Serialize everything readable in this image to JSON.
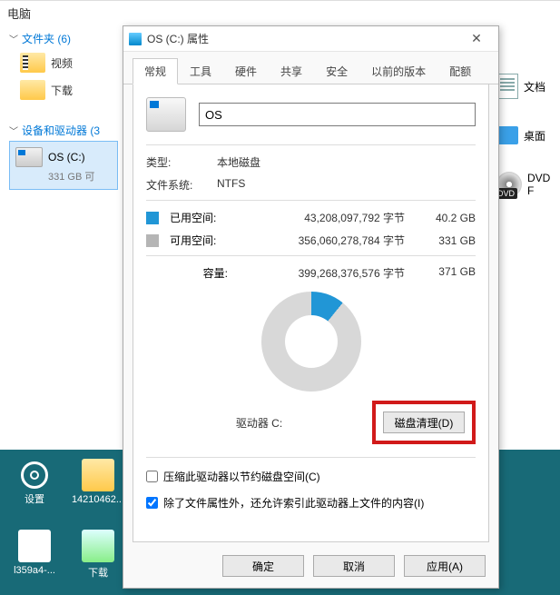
{
  "explorer": {
    "header": "电脑",
    "folders_group": "文件夹 (6)",
    "devices_group": "设备和驱动器 (3",
    "video": "视频",
    "downloads": "下载",
    "drive_c_name": "OS (C:)",
    "drive_c_sub": "331 GB 可",
    "doc": "文档",
    "desktop": "桌面",
    "dvd": "DVD F",
    "dvd_badge": "DVD"
  },
  "desktop_icons": {
    "settings": "设置",
    "folder1": "14210462...",
    "folder2": "l359a4-...",
    "downloads": "下载"
  },
  "dialog": {
    "title": "OS (C:) 属性",
    "tabs": [
      "常规",
      "工具",
      "硬件",
      "共享",
      "安全",
      "以前的版本",
      "配额"
    ],
    "drive_name": "OS",
    "type_label": "类型:",
    "type_value": "本地磁盘",
    "fs_label": "文件系统:",
    "fs_value": "NTFS",
    "used_label": "已用空间:",
    "used_bytes": "43,208,097,792 字节",
    "used_gb": "40.2 GB",
    "free_label": "可用空间:",
    "free_bytes": "356,060,278,784 字节",
    "free_gb": "331 GB",
    "cap_label": "容量:",
    "cap_bytes": "399,268,376,576 字节",
    "cap_gb": "371 GB",
    "drive_label": "驱动器 C:",
    "cleanup_btn": "磁盘清理(D)",
    "compress_label": "压缩此驱动器以节约磁盘空间(C)",
    "index_label": "除了文件属性外，还允许索引此驱动器上文件的内容(I)",
    "ok": "确定",
    "cancel": "取消",
    "apply": "应用(A)"
  },
  "chart_data": {
    "type": "pie",
    "title": "驱动器 C:",
    "series": [
      {
        "name": "已用空间",
        "value": 40.2,
        "bytes": 43208097792,
        "color": "#2196d6"
      },
      {
        "name": "可用空间",
        "value": 331,
        "bytes": 356060278784,
        "color": "#d8d8d8"
      }
    ],
    "total": {
      "value": 371,
      "bytes": 399268376576,
      "unit": "GB"
    }
  }
}
